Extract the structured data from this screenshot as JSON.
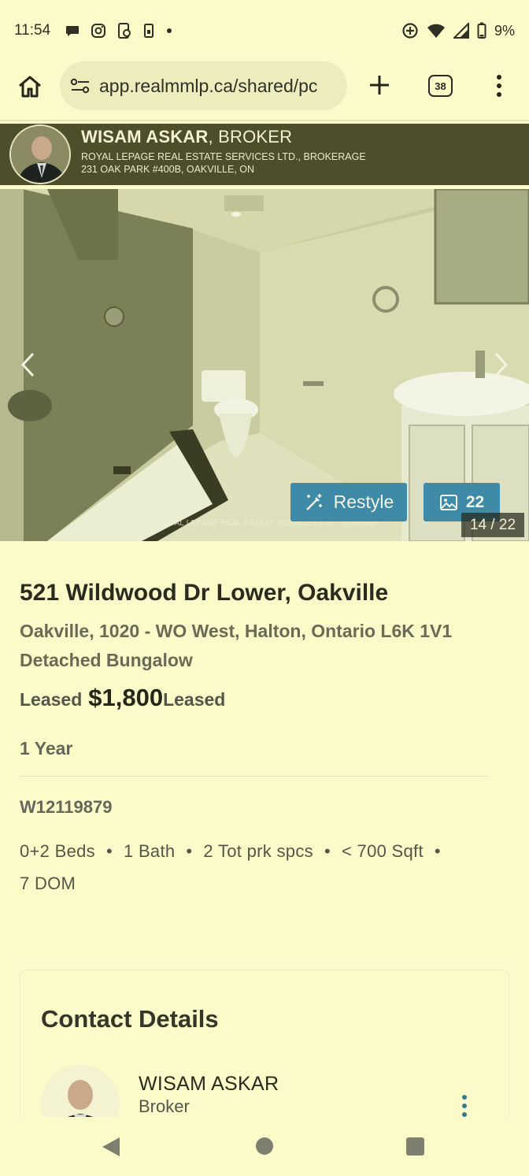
{
  "status_bar": {
    "time": "11:54",
    "battery": "9%",
    "icons": [
      "chat-bubble-icon",
      "instagram-icon",
      "phone-app-icon",
      "sim-icon",
      "dot-icon",
      "sync-icon",
      "wifi-icon",
      "signal-icon",
      "battery-icon"
    ]
  },
  "browser": {
    "url": "app.realmmlp.ca/shared/pc",
    "tab_count": "38"
  },
  "agent_banner": {
    "name": "WISAM ASKAR",
    "title": ", BROKER",
    "brokerage": "ROYAL LEPAGE REAL ESTATE SERVICES LTD., BROKERAGE",
    "address": "231 OAK PARK #400B, OAKVILLE, ON"
  },
  "gallery": {
    "restyle_label": "Restyle",
    "photo_count": "22",
    "counter": "14 / 22",
    "watermark": "ROYAL LEPAGE REAL ESTATE SERVICES LTD., Brokerage"
  },
  "listing": {
    "address": "521 Wildwood Dr Lower, Oakville",
    "area": "Oakville, 1020 - WO West, Halton, Ontario L6K 1V1",
    "type": "Detached Bungalow",
    "status_prefix": "Leased",
    "price": "$1,800",
    "status_suffix": "Leased",
    "term": "1 Year",
    "mls": "W12119879",
    "stats": [
      "0+2 Beds",
      "1 Bath",
      "2 Tot prk spcs",
      "< 700 Sqft",
      "7 DOM"
    ]
  },
  "contact": {
    "heading": "Contact Details",
    "name": "WISAM ASKAR",
    "role": "Broker"
  },
  "colors": {
    "background": "#fbfbca",
    "banner": "#4d4e2a",
    "accent_button": "#3f8aa6"
  }
}
